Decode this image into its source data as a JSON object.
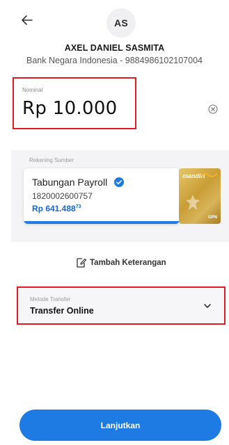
{
  "recipient": {
    "initials": "AS",
    "name": "AXEL DANIEL SASMITA",
    "bank_account": "Bank Negara Indonesia - 9884986102107004"
  },
  "nominal": {
    "label": "Nominal",
    "value": "Rp 10.000"
  },
  "source": {
    "label": "Rekening Sumber",
    "account_name": "Tabungan Payroll",
    "account_number": "1820002600757",
    "balance_main": "Rp 641.488",
    "balance_decimal": "73",
    "card_brand": "mandiri",
    "card_network": "GPN"
  },
  "note": {
    "label": "Tambah Keterangan"
  },
  "transfer_method": {
    "label": "Metode Transfer",
    "value": "Transfer Online"
  },
  "actions": {
    "continue_label": "Lanjutkan"
  },
  "colors": {
    "accent": "#1e7be3",
    "highlight_border": "#e01b24"
  },
  "icons": {
    "back": "arrow-left-icon",
    "clear": "clear-circle-icon",
    "verified": "verified-check-icon",
    "note": "edit-note-icon",
    "dropdown": "chevron-down-icon"
  }
}
